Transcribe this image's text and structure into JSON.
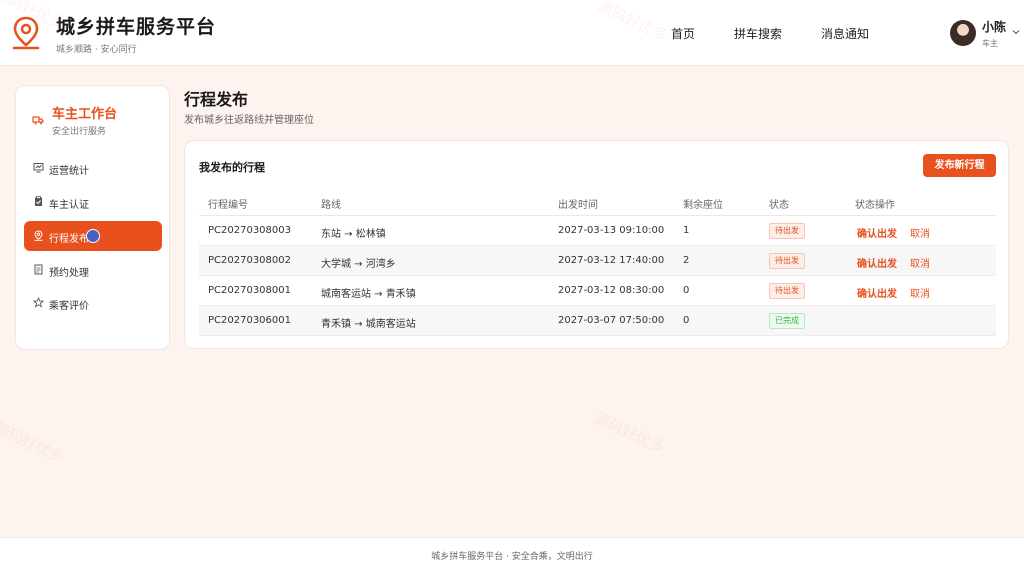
{
  "header": {
    "title": "城乡拼车服务平台",
    "subtitle": "城乡顺路 · 安心同行",
    "nav": [
      "首页",
      "拼车搜索",
      "消息通知"
    ],
    "user": {
      "name": "小陈",
      "role": "车主"
    }
  },
  "sidebar": {
    "title": "车主工作台",
    "subtitle": "安全出行服务",
    "items": [
      {
        "label": "运营统计",
        "icon": "chart-icon"
      },
      {
        "label": "车主认证",
        "icon": "clipboard-icon"
      },
      {
        "label": "行程发布",
        "icon": "location-pin-icon",
        "active": true
      },
      {
        "label": "预约处理",
        "icon": "document-icon"
      },
      {
        "label": "乘客评价",
        "icon": "star-icon"
      }
    ]
  },
  "main": {
    "title": "行程发布",
    "subtitle": "发布城乡往返路线并管理座位",
    "card_title": "我发布的行程",
    "publish_button": "发布新行程",
    "columns": [
      "行程编号",
      "路线",
      "出发时间",
      "剩余座位",
      "状态",
      "状态操作"
    ],
    "rows": [
      {
        "id": "PC20270308003",
        "route": "东站 → 松林镇",
        "time": "2027-03-13 09:10:00",
        "seats": "1",
        "status": "待出发",
        "actions": [
          "确认出发",
          "取消"
        ]
      },
      {
        "id": "PC20270308002",
        "route": "大学城 → 河湾乡",
        "time": "2027-03-12 17:40:00",
        "seats": "2",
        "status": "待出发",
        "actions": [
          "确认出发",
          "取消"
        ]
      },
      {
        "id": "PC20270308001",
        "route": "城南客运站 → 青禾镇",
        "time": "2027-03-12 08:30:00",
        "seats": "0",
        "status": "待出发",
        "actions": [
          "确认出发",
          "取消"
        ]
      },
      {
        "id": "PC20270306001",
        "route": "青禾镇 → 城南客运站",
        "time": "2027-03-07 07:50:00",
        "seats": "0",
        "status": "已完成",
        "actions": []
      }
    ]
  },
  "watermark": "源码好优多",
  "footer": "城乡拼车服务平台 · 安全合乘，文明出行",
  "colors": {
    "accent": "#e8501e",
    "success": "#3bb34a"
  }
}
